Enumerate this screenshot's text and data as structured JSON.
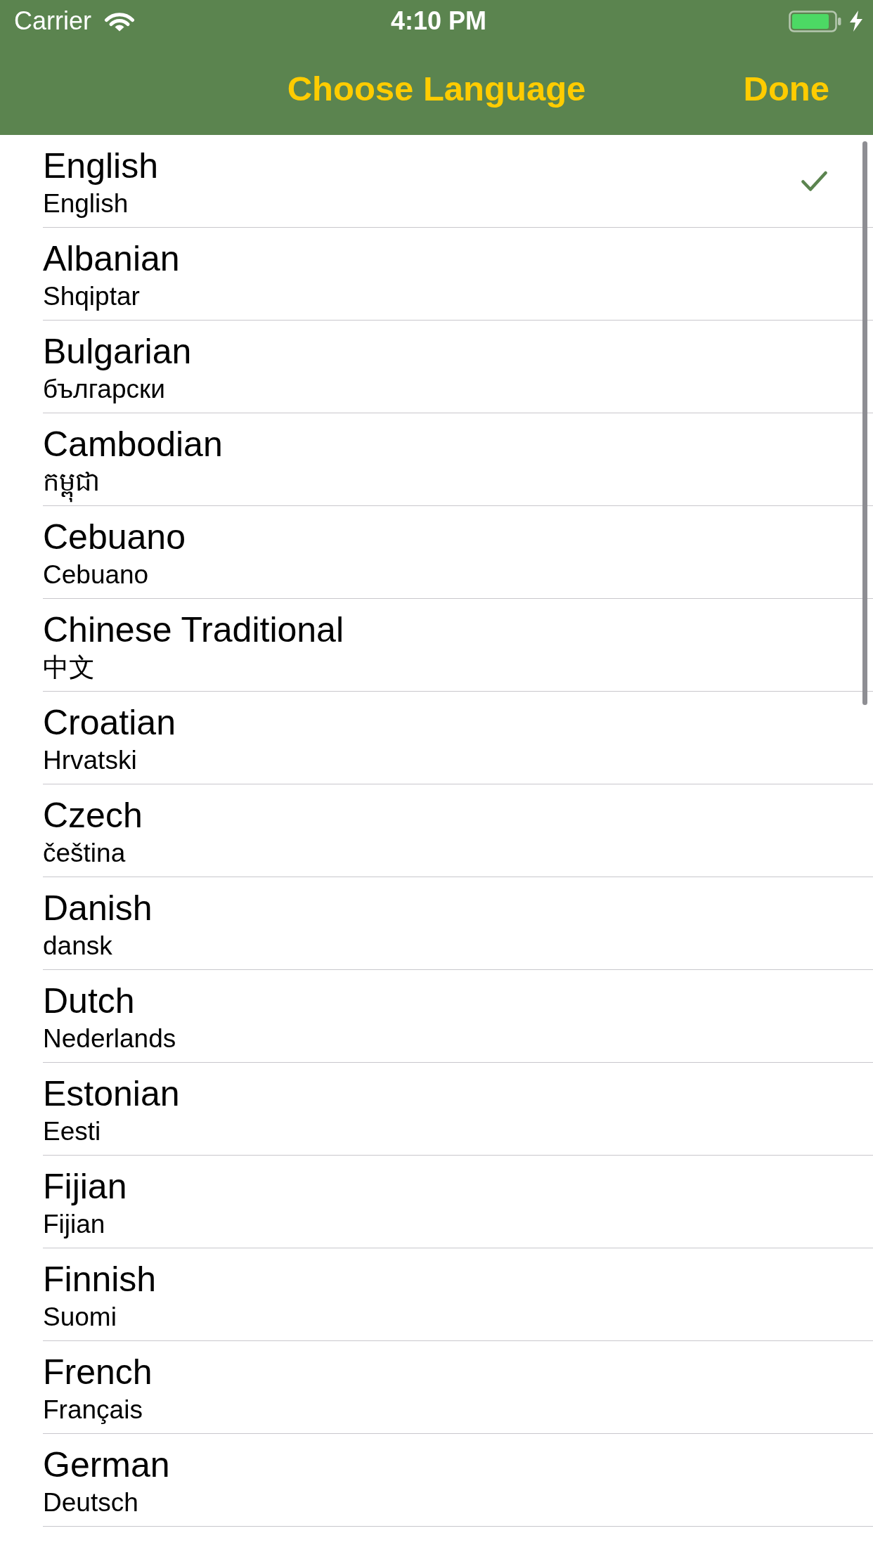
{
  "status_bar": {
    "carrier": "Carrier",
    "time": "4:10 PM"
  },
  "nav_bar": {
    "title": "Choose Language",
    "done": "Done"
  },
  "languages": [
    {
      "name": "English",
      "native": "English",
      "selected": true
    },
    {
      "name": "Albanian",
      "native": "Shqiptar",
      "selected": false
    },
    {
      "name": "Bulgarian",
      "native": "български",
      "selected": false
    },
    {
      "name": "Cambodian",
      "native": "កម្ពុជា",
      "selected": false
    },
    {
      "name": "Cebuano",
      "native": "Cebuano",
      "selected": false
    },
    {
      "name": "Chinese Traditional",
      "native": "中文",
      "selected": false
    },
    {
      "name": "Croatian",
      "native": "Hrvatski",
      "selected": false
    },
    {
      "name": "Czech",
      "native": "čeština",
      "selected": false
    },
    {
      "name": "Danish",
      "native": "dansk",
      "selected": false
    },
    {
      "name": "Dutch",
      "native": "Nederlands",
      "selected": false
    },
    {
      "name": "Estonian",
      "native": "Eesti",
      "selected": false
    },
    {
      "name": "Fijian",
      "native": "Fijian",
      "selected": false
    },
    {
      "name": "Finnish",
      "native": "Suomi",
      "selected": false
    },
    {
      "name": "French",
      "native": "Français",
      "selected": false
    },
    {
      "name": "German",
      "native": "Deutsch",
      "selected": false
    }
  ]
}
